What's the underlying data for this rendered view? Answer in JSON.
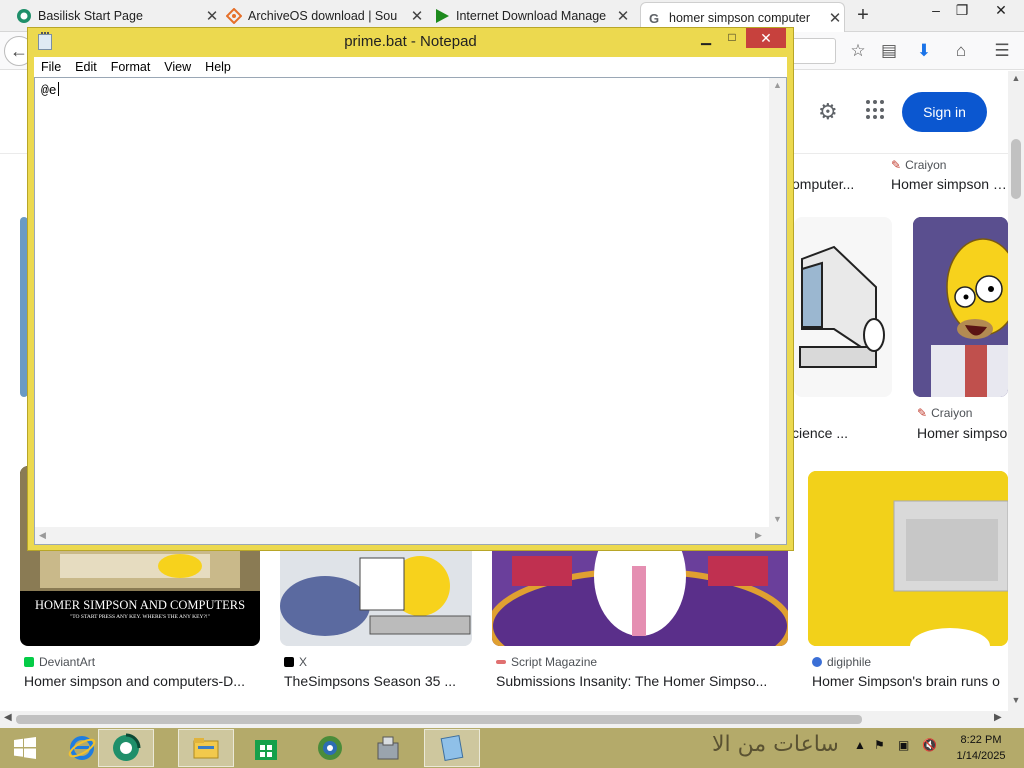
{
  "browser": {
    "tabs": [
      {
        "title": "Basilisk Start Page",
        "icon": "basilisk-icon",
        "active": false
      },
      {
        "title": "ArchiveOS download | Sou",
        "icon": "sourceforge-icon",
        "active": false
      },
      {
        "title": "Internet Download Manage",
        "icon": "idm-icon",
        "active": false
      },
      {
        "title": "homer simpson computer",
        "icon": "google-icon",
        "active": true
      }
    ],
    "new_tab": "+",
    "window_controls": {
      "minimize": "–",
      "maximize": "❐",
      "close": "✕"
    }
  },
  "google": {
    "sign_in": "Sign in",
    "top_row": [
      {
        "caption": "omputer..."
      },
      {
        "source": "Craiyon",
        "caption": "Homer simpson wo"
      }
    ],
    "middle_row": [
      {
        "caption": "cience ..."
      },
      {
        "source": "Craiyon",
        "caption": "Homer simpso"
      }
    ],
    "bottom_row": [
      {
        "source": "DeviantArt",
        "caption": "Homer simpson and computers-D...",
        "image_title": "HOMER SIMPSON AND COMPUTERS",
        "image_subtitle": "\"TO START PRESS ANY KEY. WHERE'S THE ANY KEY?!\""
      },
      {
        "source": "X",
        "caption": "TheSimpsons Season 35 ..."
      },
      {
        "source": "Script Magazine",
        "caption": "Submissions Insanity: The Homer Simpso..."
      },
      {
        "source": "digiphile",
        "caption": "Homer Simpson's brain runs o"
      }
    ]
  },
  "notepad": {
    "title": "prime.bat - Notepad",
    "menu": [
      "File",
      "Edit",
      "Format",
      "View",
      "Help"
    ],
    "content": "@e",
    "close": "✕",
    "minimize": "▬",
    "maximize": "□"
  },
  "taskbar": {
    "arabic_text": "ساعات من الا",
    "clock_time": "8:22 PM",
    "clock_date": "1/14/2025"
  },
  "colors": {
    "notepad_frame": "#ecd94f",
    "google_blue": "#0b57d0",
    "taskbar": "#b4aa6a"
  }
}
